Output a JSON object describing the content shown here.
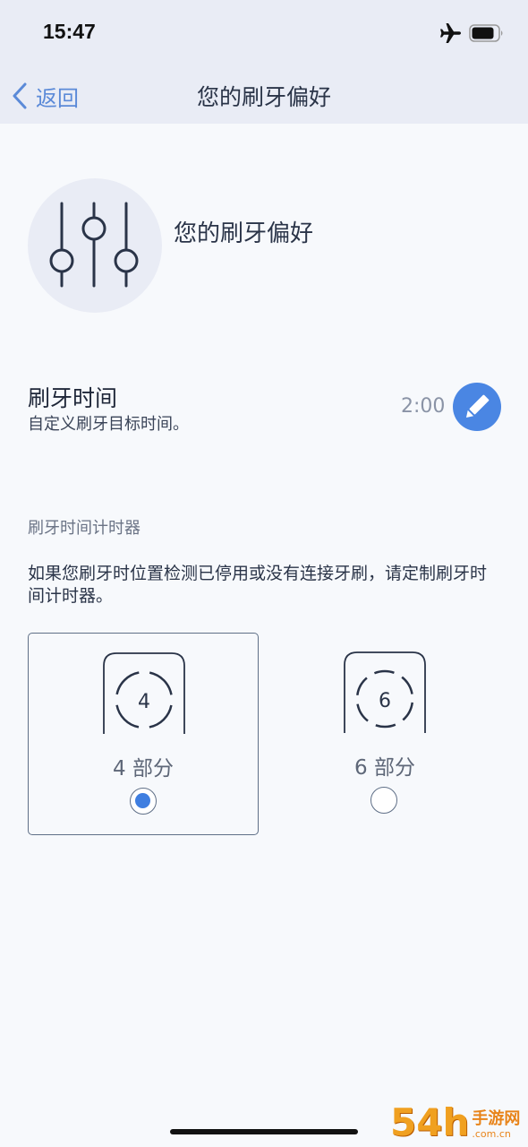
{
  "status_bar": {
    "time": "15:47"
  },
  "nav": {
    "back_label": "返回",
    "title": "您的刷牙偏好"
  },
  "header": {
    "title": "您的刷牙偏好",
    "icon": "sliders-icon"
  },
  "duration": {
    "title": "刷牙时间",
    "description": "自定义刷牙目标时间。",
    "value": "2:00",
    "edit_icon": "pencil-icon"
  },
  "timer": {
    "heading": "刷牙时间计时器",
    "description": "如果您刷牙时位置检测已停用或没有连接牙刷，请定制刷牙时间计时器。",
    "options": [
      {
        "number": "4",
        "label": "4 部分",
        "selected": true
      },
      {
        "number": "6",
        "label": "6 部分",
        "selected": false
      }
    ]
  },
  "watermark": {
    "big": "54h",
    "cn": "手游网",
    "url": ".com.cn"
  },
  "colors": {
    "accent": "#4a86e3",
    "header_bg": "#e9ecf5",
    "page_bg": "#f7f9fc"
  }
}
